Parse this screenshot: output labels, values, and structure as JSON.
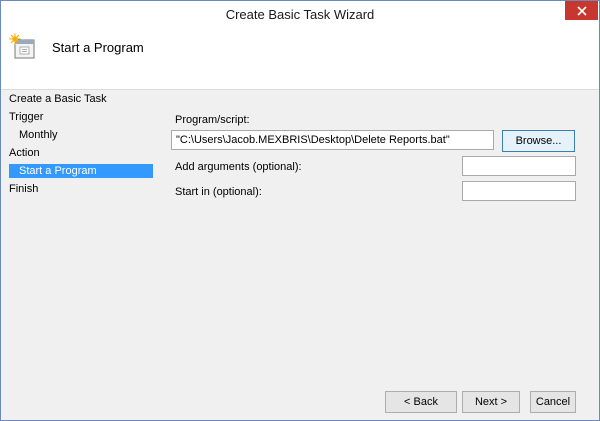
{
  "window": {
    "title": "Create Basic Task Wizard",
    "close_icon": "close-icon"
  },
  "header": {
    "icon": "task-scheduler-icon",
    "title": "Start a Program"
  },
  "sidebar": {
    "items": [
      {
        "label": "Create a Basic Task",
        "selected": false
      },
      {
        "label": "Trigger",
        "selected": false
      },
      {
        "label": "Monthly",
        "selected": false
      },
      {
        "label": "Action",
        "selected": false
      },
      {
        "label": "Start a Program",
        "selected": true
      },
      {
        "label": "Finish",
        "selected": false
      }
    ]
  },
  "form": {
    "program_label": "Program/script:",
    "program_value": "\"C:\\Users\\Jacob.MEXBRIS\\Desktop\\Delete Reports.bat\"",
    "browse_label": "Browse...",
    "arguments_label": "Add arguments (optional):",
    "arguments_value": "",
    "start_in_label": "Start in (optional):",
    "start_in_value": ""
  },
  "buttons": {
    "back": "< Back",
    "next": "Next >",
    "cancel": "Cancel"
  },
  "colors": {
    "selection": "#3399ff",
    "close_button": "#c7372f",
    "window_border": "#6b8ab8"
  }
}
